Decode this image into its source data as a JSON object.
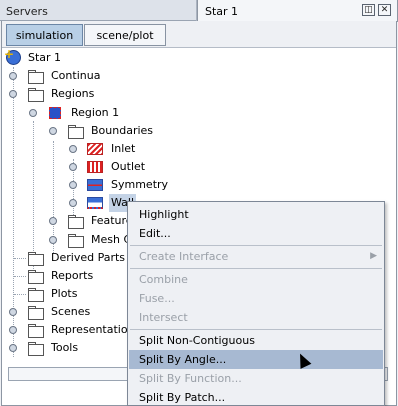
{
  "tabs": {
    "servers": "Servers",
    "active": "Star 1",
    "restore_glyph": "◫",
    "close_glyph": "✕"
  },
  "subtabs": [
    "simulation",
    "scene/plot"
  ],
  "tree": {
    "root": "Star 1",
    "items": {
      "continua": "Continua",
      "regions": "Regions",
      "region1": "Region 1",
      "boundaries": "Boundaries",
      "inlet": "Inlet",
      "outlet": "Outlet",
      "symmetry": "Symmetry",
      "wall": "Wall",
      "feature": "Feature",
      "mesh": "Mesh C",
      "derived": "Derived Parts",
      "reports": "Reports",
      "plots": "Plots",
      "scenes": "Scenes",
      "representations": "Representation",
      "tools": "Tools"
    }
  },
  "context_menu": {
    "highlight": "Highlight",
    "edit": "Edit...",
    "create_interface": "Create Interface",
    "combine": "Combine",
    "fuse": "Fuse...",
    "intersect": "Intersect",
    "split_non_contiguous": "Split Non-Contiguous",
    "split_by_angle": "Split By Angle...",
    "split_by_function": "Split By Function...",
    "split_by_patch": "Split By Patch...",
    "highlighted_item": "Split By Angle..."
  },
  "colors": {
    "selection": "#a7b9d2",
    "active_subtab": "#b8cfe6",
    "disabled_text": "#9aa0a8"
  }
}
